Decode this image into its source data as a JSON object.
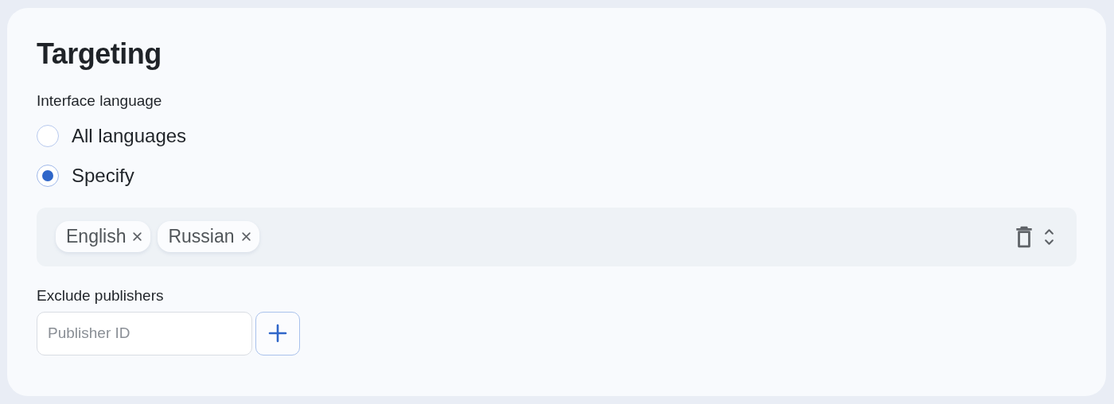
{
  "section": {
    "title": "Targeting"
  },
  "language": {
    "label": "Interface language",
    "options": [
      {
        "label": "All languages",
        "selected": false
      },
      {
        "label": "Specify",
        "selected": true
      }
    ],
    "tags": [
      {
        "label": "English"
      },
      {
        "label": "Russian"
      }
    ]
  },
  "exclude": {
    "label": "Exclude publishers",
    "placeholder": "Publisher ID"
  }
}
